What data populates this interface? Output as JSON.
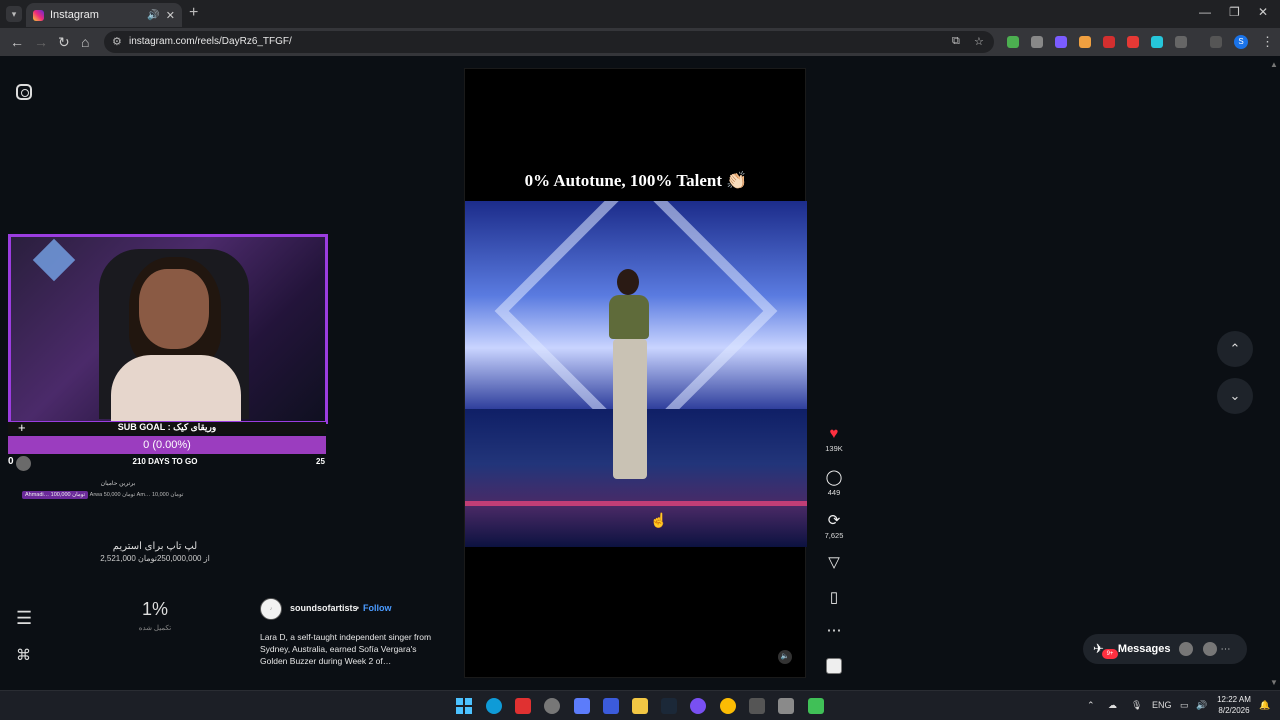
{
  "browser": {
    "tab_title": "Instagram",
    "new_tab": "+",
    "url": "instagram.com/reels/DayRz6_TFGF/",
    "profile_initial": "S"
  },
  "stream": {
    "subgoal_label": "SUB GOAL : وریقای کیک",
    "subgoal_value": "0 (0.00%)",
    "goal_start": "0",
    "days_to_go": "210 DAYS TO GO",
    "goal_end": "25",
    "donors_title": "برترین حامیان",
    "donor_1": "Ahmadi… 100,000 تومان",
    "donor_2": "Arwa 50,000 تومان",
    "donor_3": "Am… 10,000 تومان",
    "laptop_title": "لپ تاپ برای استریم",
    "laptop_amount": "2,521,000 از 250,000,000تومان",
    "percent": "1%",
    "percent_sub": "تکمیل شده"
  },
  "reel": {
    "title": "0% Autotune, 100% Talent 👏🏻",
    "author": "soundsofartists",
    "author_dot": "•",
    "follow": "Follow",
    "caption": "Lara D, a self-taught independent singer from Sydney, Australia, earned Sofía Vergara's Golden Buzzer during Week 2 of…"
  },
  "actions": {
    "likes": "139K",
    "comments": "449",
    "reposts": "7,625"
  },
  "messages": {
    "label": "Messages",
    "badge": "9+"
  },
  "taskbar": {
    "lang": "ENG",
    "time": "12:22 AM",
    "date": "8/2/2026"
  },
  "colors": {
    "accent_purple": "#9b3dbf",
    "like_red": "#ff3040",
    "follow_blue": "#4b9bff"
  }
}
